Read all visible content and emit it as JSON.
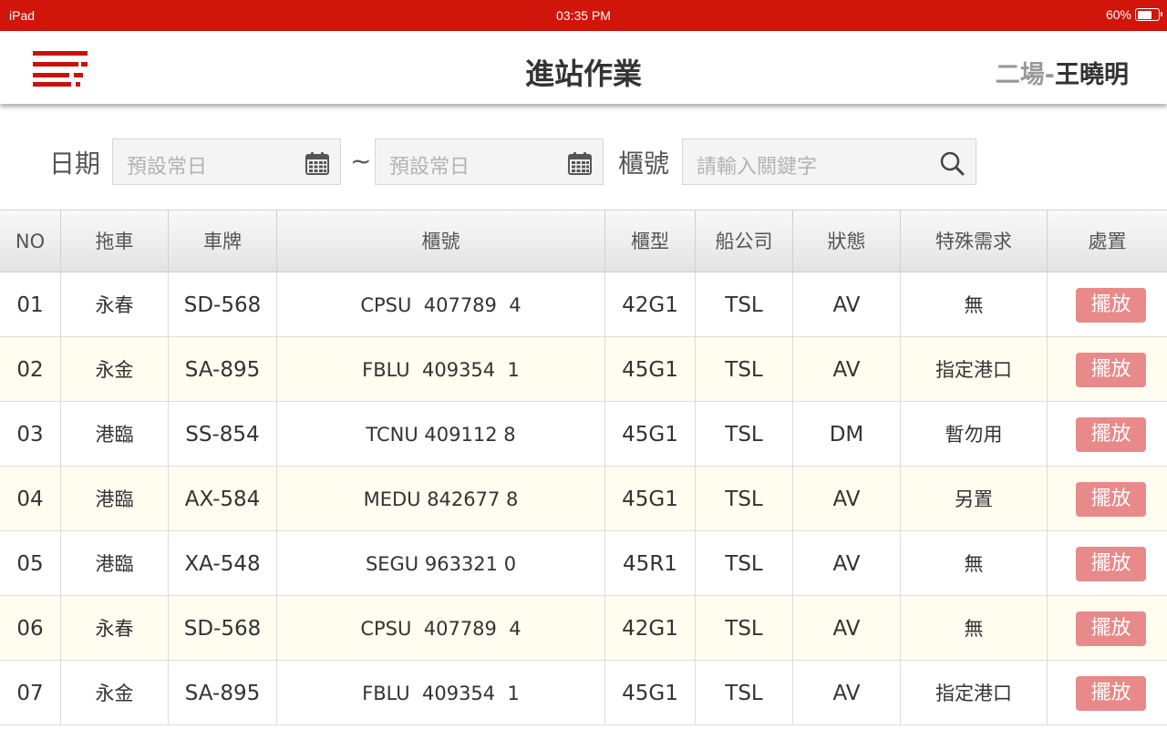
{
  "status_bar": {
    "device": "iPad",
    "time": "03:35 PM",
    "battery": "60%"
  },
  "header": {
    "title": "進站作業",
    "site": "二場-",
    "user": "王曉明"
  },
  "filters": {
    "date_label": "日期",
    "date_from_placeholder": "預設常日",
    "separator": "~",
    "date_to_placeholder": "預設常日",
    "container_label": "櫃號",
    "search_placeholder": "請輸入關鍵字"
  },
  "table": {
    "columns": [
      "NO",
      "拖車",
      "車牌",
      "櫃號",
      "櫃型",
      "船公司",
      "狀態",
      "特殊需求",
      "處置"
    ],
    "action_label": "擺放",
    "rows": [
      {
        "no": "01",
        "tractor": "永春",
        "plate": "SD-568",
        "container": "CPSU  407789  4",
        "type": "42G1",
        "carrier": "TSL",
        "status": "AV",
        "special": "無"
      },
      {
        "no": "02",
        "tractor": "永金",
        "plate": "SA-895",
        "container": "FBLU  409354  1",
        "type": "45G1",
        "carrier": "TSL",
        "status": "AV",
        "special": "指定港口"
      },
      {
        "no": "03",
        "tractor": "港臨",
        "plate": "SS-854",
        "container": "TCNU 409112 8",
        "type": "45G1",
        "carrier": "TSL",
        "status": "DM",
        "special": "暫勿用"
      },
      {
        "no": "04",
        "tractor": "港臨",
        "plate": "AX-584",
        "container": "MEDU 842677 8",
        "type": "45G1",
        "carrier": "TSL",
        "status": "AV",
        "special": "另置"
      },
      {
        "no": "05",
        "tractor": "港臨",
        "plate": "XA-548",
        "container": "SEGU 963321 0",
        "type": "45R1",
        "carrier": "TSL",
        "status": "AV",
        "special": "無"
      },
      {
        "no": "06",
        "tractor": "永春",
        "plate": "SD-568",
        "container": "CPSU  407789  4",
        "type": "42G1",
        "carrier": "TSL",
        "status": "AV",
        "special": "無"
      },
      {
        "no": "07",
        "tractor": "永金",
        "plate": "SA-895",
        "container": "FBLU  409354  1",
        "type": "45G1",
        "carrier": "TSL",
        "status": "AV",
        "special": "指定港口"
      }
    ]
  },
  "colors": {
    "brand_red": "#d0150a",
    "action_button": "#e8898a",
    "row_alt": "#fffdf0"
  },
  "icons": [
    "menu-icon",
    "calendar-icon",
    "search-icon",
    "battery-icon"
  ]
}
